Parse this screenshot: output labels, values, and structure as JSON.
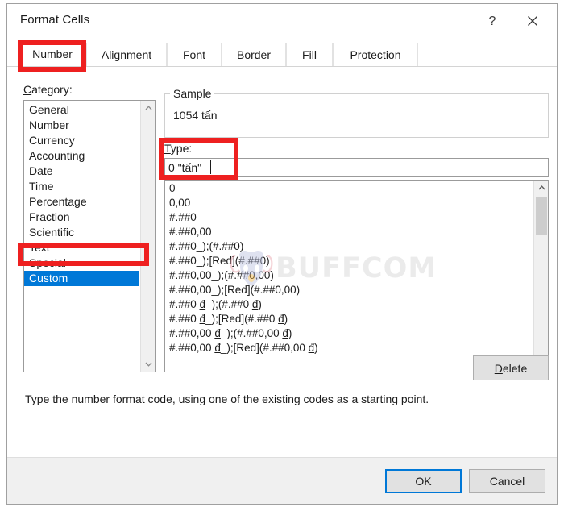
{
  "window": {
    "title": "Format Cells",
    "help_icon": "question-mark-icon",
    "close_icon": "close-x-icon"
  },
  "tabs": [
    {
      "label": "Number",
      "active": true
    },
    {
      "label": "Alignment",
      "active": false
    },
    {
      "label": "Font",
      "active": false
    },
    {
      "label": "Border",
      "active": false
    },
    {
      "label": "Fill",
      "active": false
    },
    {
      "label": "Protection",
      "active": false
    }
  ],
  "category": {
    "label": "Category:",
    "label_accel": "C",
    "label_rest": "ategory:",
    "items": [
      {
        "label": "General",
        "selected": false
      },
      {
        "label": "Number",
        "selected": false
      },
      {
        "label": "Currency",
        "selected": false
      },
      {
        "label": "Accounting",
        "selected": false
      },
      {
        "label": "Date",
        "selected": false
      },
      {
        "label": "Time",
        "selected": false
      },
      {
        "label": "Percentage",
        "selected": false
      },
      {
        "label": "Fraction",
        "selected": false
      },
      {
        "label": "Scientific",
        "selected": false
      },
      {
        "label": "Text",
        "selected": false
      },
      {
        "label": "Special",
        "selected": false
      },
      {
        "label": "Custom",
        "selected": true
      }
    ],
    "scrollbar": {
      "up_icon": "chevron-up-icon",
      "down_icon": "chevron-down-icon"
    }
  },
  "sample": {
    "legend": "Sample",
    "value": "1054 tấn"
  },
  "type": {
    "label_accel": "T",
    "label_rest": "ype:",
    "value": "0 \"tấn\"",
    "items": [
      "0",
      "0,00",
      "#.##0",
      "#.##0,00",
      "#.##0_);(#.##0)",
      "#.##0_);[Red](#.##0)",
      "#.##0,00_);(#.##0,00)",
      "#.##0,00_);[Red](#.##0,00)",
      "#.##0 đ_);(#.##0 đ)",
      "#.##0 đ_);[Red](#.##0 đ)",
      "#.##0,00 đ_);(#.##0,00 đ)",
      "#.##0,00 đ_);[Red](#.##0,00 đ)"
    ],
    "scrollbar": {
      "up_icon": "chevron-up-icon",
      "down_icon": "chevron-down-icon"
    }
  },
  "delete_button": {
    "accel": "D",
    "rest": "elete"
  },
  "help_text": "Type the number format code, using one of the existing codes as a starting point.",
  "footer": {
    "ok_label": "OK",
    "cancel_label": "Cancel"
  },
  "watermark": {
    "text": "BUFFCOM",
    "logo_icon": "buffalo-head-logo-icon"
  },
  "annotations": {
    "color": "#ee2020",
    "boxes": [
      "number-tab",
      "type-field",
      "custom-category"
    ]
  }
}
